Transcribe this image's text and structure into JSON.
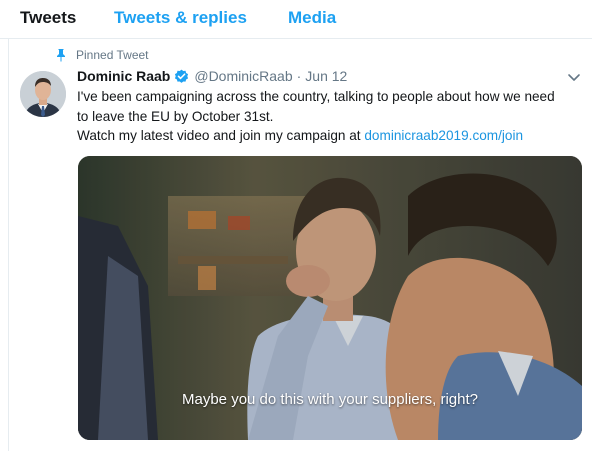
{
  "tabs": [
    {
      "label": "Tweets",
      "active": true
    },
    {
      "label": "Tweets & replies",
      "active": false
    },
    {
      "label": "Media",
      "active": false
    }
  ],
  "tweet": {
    "pinned_label": "Pinned Tweet",
    "pin_icon": "pin-icon",
    "display_name": "Dominic Raab",
    "verified_icon": "verified-badge-icon",
    "handle": "@DominicRaab",
    "separator": "·",
    "date": "Jun 12",
    "menu_icon": "chevron-down-icon",
    "text_line_1": "I've been campaigning across the country, talking to people about how we need",
    "text_line_2": "to leave the EU by October 31st.",
    "text_line_3_prefix": "Watch my latest video and join my campaign at ",
    "link_text": "dominicraab2019.com/join",
    "video_caption": "Maybe you do this with your suppliers, right?"
  },
  "colors": {
    "accent": "#1da1f2",
    "link": "#1b95e0",
    "muted": "#657786",
    "text": "#14171a"
  }
}
